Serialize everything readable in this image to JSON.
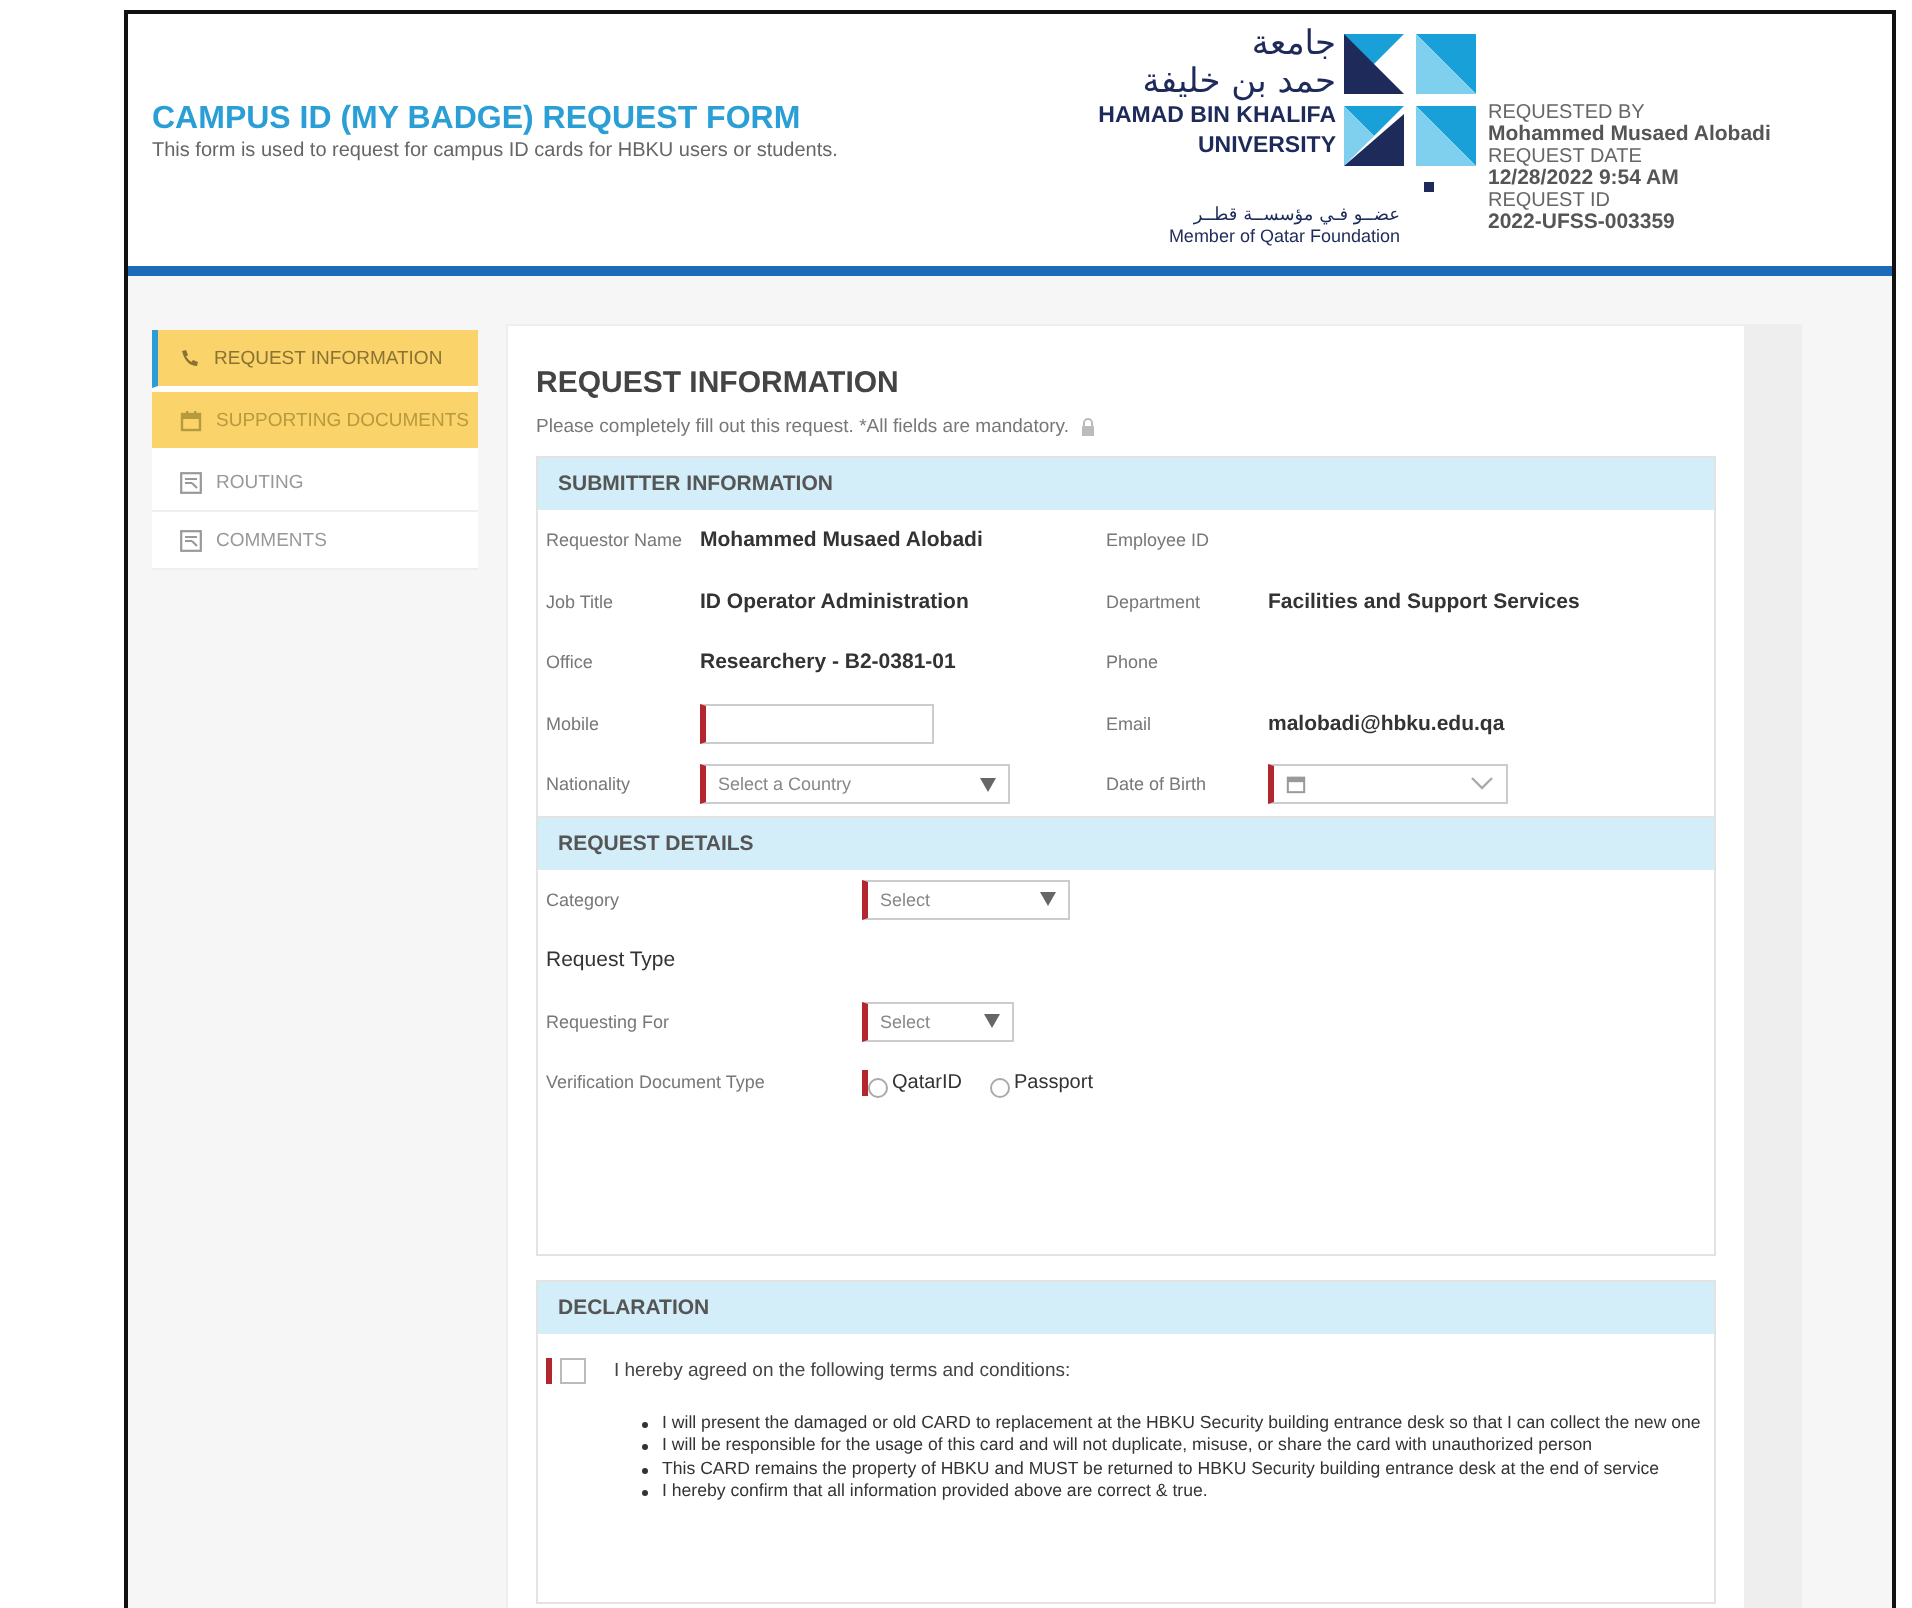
{
  "header": {
    "title": "CAMPUS ID (MY BADGE) REQUEST FORM",
    "subtitle": "This form is used to request for campus ID cards for HBKU users or students.",
    "logo": {
      "arabic_name_1": "جامعة",
      "arabic_name_2": "حمد بن خليفة",
      "name_1": "HAMAD BIN KHALIFA",
      "name_2": "UNIVERSITY",
      "arabic_member": "عضــو فـي مؤسســة قطــر",
      "member": "Member of Qatar Foundation"
    },
    "meta": [
      {
        "label": "REQUESTED BY",
        "value": "Mohammed Musaed Alobadi"
      },
      {
        "label": "REQUEST DATE",
        "value": "12/28/2022 9:54 AM"
      },
      {
        "label": "REQUEST ID",
        "value": "2022-UFSS-003359"
      }
    ]
  },
  "sidebar": {
    "items": [
      {
        "label": "REQUEST INFORMATION",
        "kind": "phone",
        "selected": true,
        "highlighted": true
      },
      {
        "label": "SUPPORTING DOCUMENTS",
        "kind": "calendar",
        "selected": false,
        "highlighted": true
      },
      {
        "label": "ROUTING",
        "kind": "form",
        "selected": false,
        "highlighted": false
      },
      {
        "label": "COMMENTS",
        "kind": "form",
        "selected": false,
        "highlighted": false
      }
    ]
  },
  "page": {
    "title": "REQUEST INFORMATION",
    "note": "Please completely fill out this request. *All fields are mandatory."
  },
  "submitter": {
    "title": "SUBMITTER INFORMATION",
    "fields": [
      {
        "label": "Requestor Name",
        "kind": "text",
        "value": "Mohammed Musaed Alobadi"
      },
      {
        "label": "Employee ID",
        "kind": "text"
      },
      {
        "label": "Job Title",
        "kind": "text",
        "value": "ID Operator Administration"
      },
      {
        "label": "Department",
        "kind": "text",
        "value": "Facilities and Support Services"
      },
      {
        "label": "Office",
        "kind": "text",
        "value": "Researchery - B2-0381-01"
      },
      {
        "label": "Phone",
        "kind": "text"
      },
      {
        "label": "Mobile",
        "kind": "input",
        "required": true
      },
      {
        "label": "Email",
        "kind": "text",
        "value": "malobadi@hbku.edu.qa"
      },
      {
        "label": "Nationality",
        "kind": "select",
        "required": true,
        "placeholder": "Select a Country"
      },
      {
        "label": "Date of Birth",
        "kind": "date",
        "required": true
      }
    ]
  },
  "details": {
    "title": "REQUEST DETAILS",
    "fields": [
      {
        "label": "Category",
        "kind": "select",
        "required": true,
        "placeholder": "Select"
      },
      {
        "label": "Request Type",
        "kind": "heading"
      },
      {
        "label": "Requesting For",
        "kind": "select",
        "required": true,
        "placeholder": "Select"
      },
      {
        "label": "Verification Document Type",
        "kind": "radio",
        "required": true,
        "options": [
          {
            "label": "QatarID",
            "selected": false
          },
          {
            "label": "Passport",
            "selected": false
          }
        ]
      }
    ]
  },
  "declaration": {
    "title": "DECLARATION",
    "checked": false,
    "required": true,
    "text": "I hereby agreed on the following terms and conditions:",
    "terms": [
      "I will present the damaged or old CARD to replacement at the HBKU Security building entrance desk so that I can collect the new one",
      "I will be responsible for the usage of this card and will not duplicate, misuse, or share the card with unauthorized person",
      "This CARD remains the property of HBKU and MUST be returned to HBKU Security building entrance desk at the end of service",
      "I hereby confirm that all information provided above are correct & true."
    ]
  }
}
